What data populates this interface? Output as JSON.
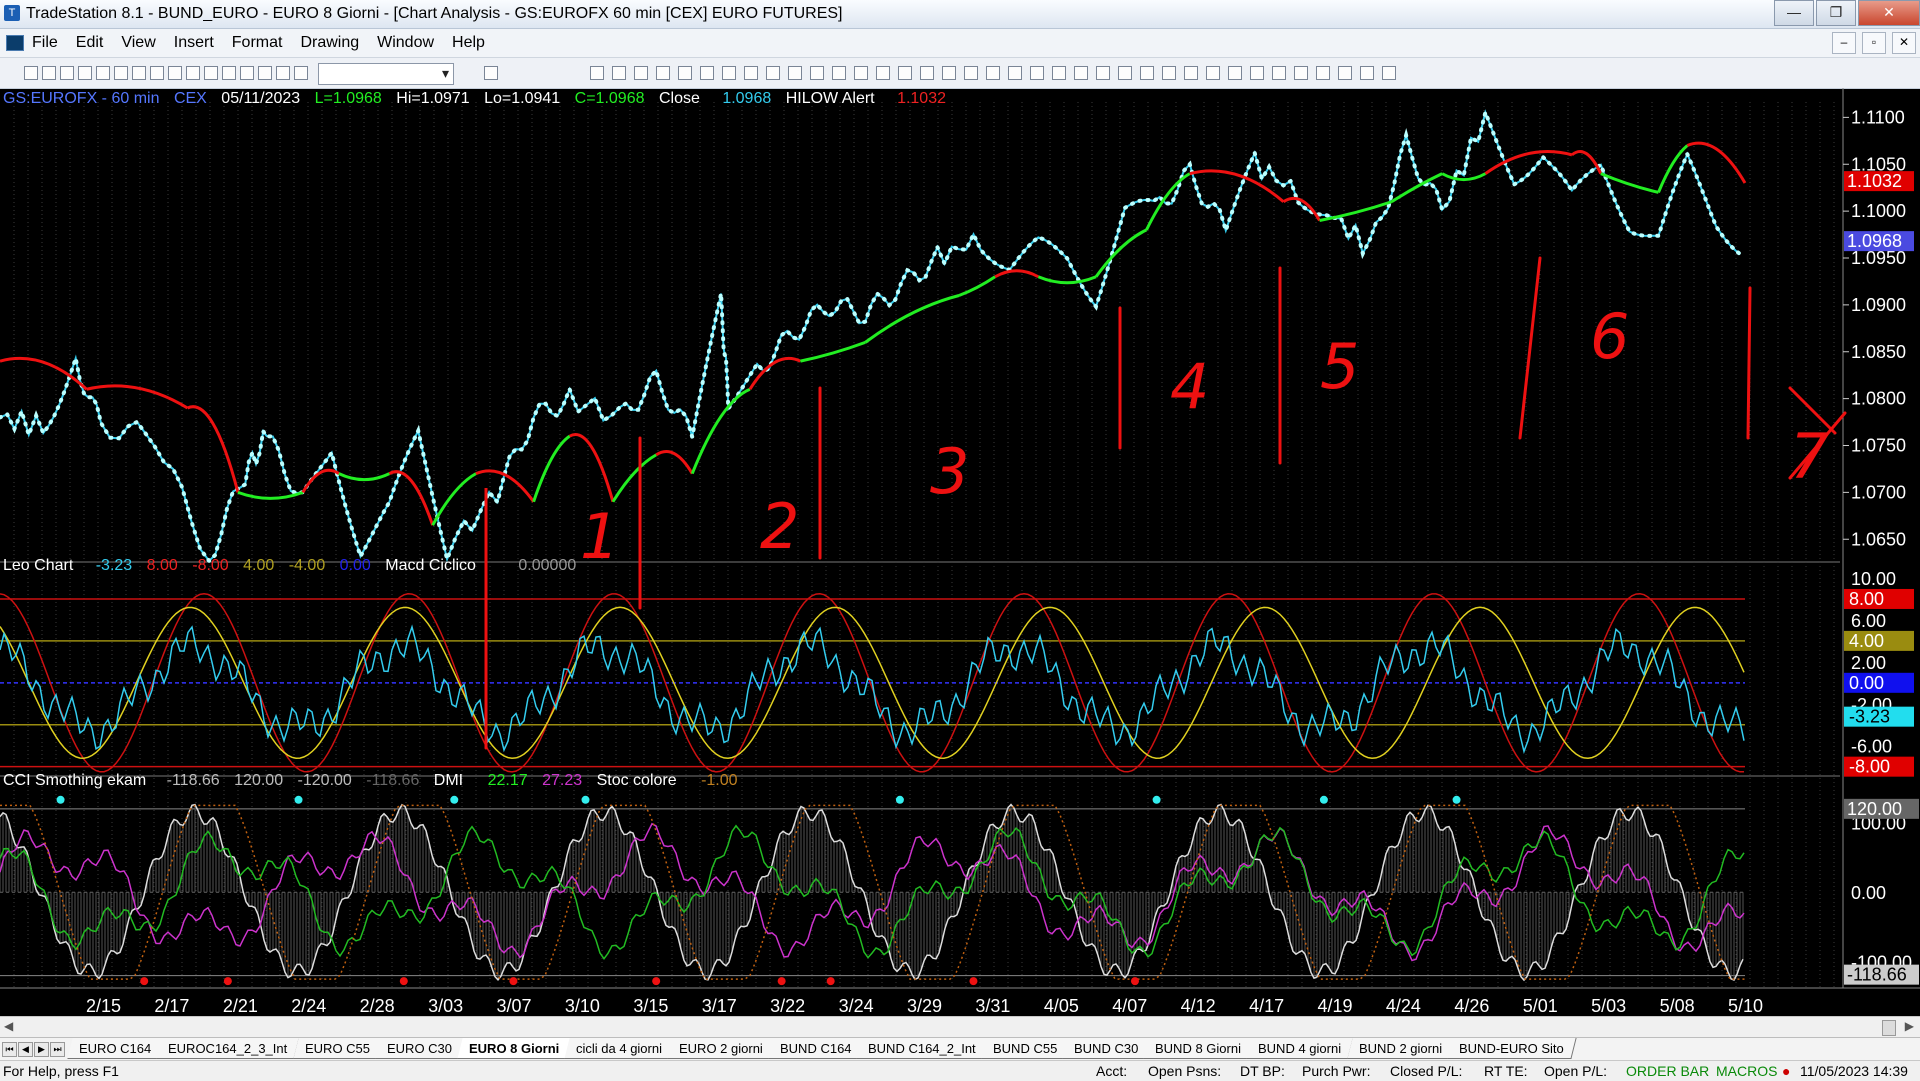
{
  "window": {
    "title": "TradeStation 8.1 - BUND_EURO - EURO 8 Giorni - [Chart Analysis - GS:EUROFX  60 min  [CEX] EURO FUTURES]"
  },
  "menu": [
    "File",
    "Edit",
    "View",
    "Insert",
    "Format",
    "Drawing",
    "Window",
    "Help"
  ],
  "price_header": {
    "symbol": "GS:EUROFX - 60 min",
    "exchange": "CEX",
    "date": "05/11/2023",
    "last": "L=1.0968",
    "hi": "Hi=1.0971",
    "lo": "Lo=1.0941",
    "close_v": "C=1.0968",
    "close_label": "Close",
    "close_value": "1.0968",
    "alert_label": "HILOW Alert",
    "alert_value": "1.1032"
  },
  "osc_header": {
    "name": "Leo Chart",
    "v1": "-3.23",
    "v2": "8.00",
    "v3": "-8.00",
    "v4": "4.00",
    "v5": "-4.00",
    "v6": "0.00",
    "macd": "Macd Ciclico",
    "macd_v": "0.00000"
  },
  "cci_header": {
    "name": "CCI Smothing ekam",
    "v1": "-118.66",
    "v2": "120.00",
    "v3": "-120.00",
    "v4": "-118.66",
    "dmi": "DMI",
    "d1": "22.17",
    "d2": "27.23",
    "stoc": "Stoc colore",
    "s1": "-1.00"
  },
  "price_axis": [
    "1.1100",
    "1.1050",
    "1.1000",
    "1.0950",
    "1.0900",
    "1.0850",
    "1.0800",
    "1.0750",
    "1.0700",
    "1.0650"
  ],
  "price_badges": {
    "alert": "1.1032",
    "last": "1.0968"
  },
  "osc_axis": [
    "10.00",
    "6.00",
    "2.00",
    "-2.00",
    "-6.00"
  ],
  "osc_badges": [
    "8.00",
    "4.00",
    "0.00",
    "-3.23",
    "-8.00"
  ],
  "cci_axis": [
    "100.00",
    "0.00",
    "-100.00"
  ],
  "cci_badges": [
    "120.00",
    "-118.66"
  ],
  "dates": [
    "2/15",
    "2/17",
    "2/21",
    "2/24",
    "2/28",
    "3/03",
    "3/07",
    "3/10",
    "3/15",
    "3/17",
    "3/22",
    "3/24",
    "3/29",
    "3/31",
    "4/05",
    "4/07",
    "4/12",
    "4/17",
    "4/19",
    "4/24",
    "4/26",
    "5/01",
    "5/03",
    "5/08",
    "5/10"
  ],
  "annotations": [
    "1",
    "2",
    "3",
    "4",
    "5",
    "6",
    "7"
  ],
  "tabs": [
    "EURO C164",
    "EUROC164_2_3_Int",
    "EURO C55",
    "EURO C30",
    "EURO 8 Giorni",
    "cicli da 4 giorni",
    "EURO 2 giorni",
    "BUND C164",
    "BUND C164_2_Int",
    "BUND C55",
    "BUND  C30",
    "BUND 8 Giorni",
    "BUND 4 giorni",
    "BUND 2 giorni",
    "BUND-EURO Sito"
  ],
  "active_tab": "EURO 8 Giorni",
  "status": {
    "help": "For Help, press F1",
    "acct": "Acct:",
    "open_psns": "Open Psns:",
    "dt_bp": "DT BP:",
    "purch_pwr": "Purch Pwr:",
    "closed_pl": "Closed P/L:",
    "rt_te": "RT TE:",
    "open_pl": "Open P/L:",
    "order_bar": "ORDER BAR",
    "macros": "MACROS",
    "datetime": "11/05/2023 14:39"
  },
  "colors": {
    "bg": "#000000",
    "price": "#33ccee",
    "hilo_down": "#ee1111",
    "hilo_up": "#22ee22",
    "yellow": "#e0d020",
    "magenta": "#cc33cc",
    "green_line": "#22bb22"
  }
}
